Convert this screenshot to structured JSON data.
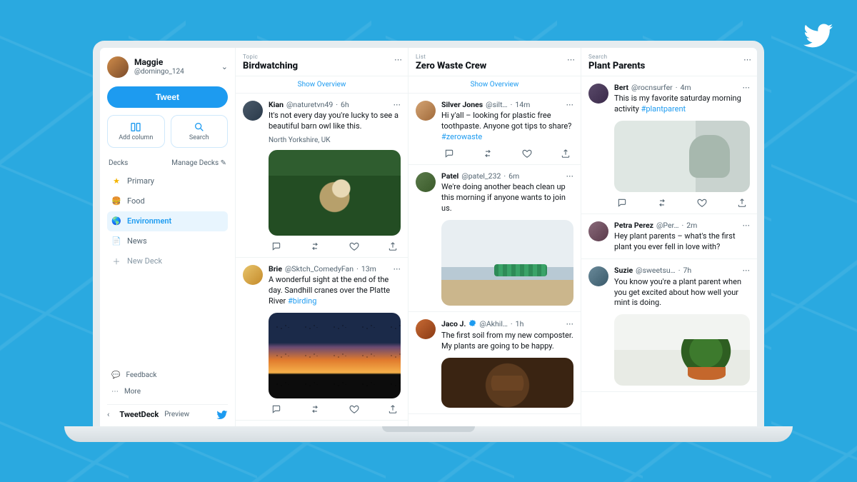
{
  "corner_icon": "twitter-bird",
  "sidebar": {
    "user": {
      "name": "Maggie",
      "handle": "@domingo_124"
    },
    "tweet_button": "Tweet",
    "quick": {
      "add_column": "Add column",
      "search": "Search"
    },
    "decks_label": "Decks",
    "manage_decks": "Manage Decks",
    "decks": [
      {
        "label": "Primary",
        "icon": "star-icon"
      },
      {
        "label": "Food",
        "icon": "food-icon"
      },
      {
        "label": "Environment",
        "icon": "globe-icon",
        "active": true
      },
      {
        "label": "News",
        "icon": "news-icon"
      }
    ],
    "new_deck": "New Deck",
    "footer": {
      "feedback": "Feedback",
      "more": "More"
    },
    "brand": {
      "name": "TweetDeck",
      "suffix": "Preview"
    }
  },
  "columns": [
    {
      "kind": "Topic",
      "title": "Birdwatching",
      "overview": "Show Overview",
      "tweets": [
        {
          "avatar": "av1",
          "name": "Kian",
          "handle": "@naturetvn49",
          "time": "6h",
          "text": "It's not every day you're lucky to see a beautiful barn owl like this.",
          "subline": "North Yorkshire, UK",
          "media": "owl"
        },
        {
          "avatar": "av2",
          "name": "Brie",
          "handle": "@Sktch_ComedyFan",
          "time": "13m",
          "text": "A wonderful sight at the end of the day. Sandhill cranes over the Platte River",
          "hashtag": "#birding",
          "media": "sunset"
        }
      ]
    },
    {
      "kind": "List",
      "title": "Zero Waste Crew",
      "overview": "Show Overview",
      "tweets": [
        {
          "avatar": "av3",
          "name": "Silver Jones",
          "handle": "@silt…",
          "time": "14m",
          "text": "Hi y'all – looking for plastic free toothpaste. Anyone got tips to share?",
          "hashtag": "#zerowaste",
          "actions_only": true
        },
        {
          "avatar": "av4",
          "name": "Patel",
          "handle": "@patel_232",
          "time": "6m",
          "text": "We're doing another beach clean up this morning if anyone wants to join us.",
          "media": "beach"
        },
        {
          "avatar": "av5",
          "name": "Jaco J.",
          "handle": "@Akhil…",
          "time": "1h",
          "verified": true,
          "text": "The first soil from my new composter. My plants are going to be happy.",
          "media": "soil"
        }
      ]
    },
    {
      "kind": "Search",
      "title": "Plant Parents",
      "tweets": [
        {
          "avatar": "av6",
          "name": "Bert",
          "handle": "@rocnsurfer",
          "time": "4m",
          "text": "This is my favorite saturday morning activity",
          "hashtag": "#plantparent",
          "media": "person"
        },
        {
          "avatar": "av7",
          "name": "Petra Perez",
          "handle": "@Per…",
          "time": "2m",
          "text": "Hey plant parents – what's the first plant you ever fell in love with?",
          "no_media": true
        },
        {
          "avatar": "av8",
          "name": "Suzie",
          "handle": "@sweetsu…",
          "time": "7h",
          "text": "You know you're a plant parent when you get excited about how well your mint is doing.",
          "media": "mint"
        }
      ]
    }
  ]
}
